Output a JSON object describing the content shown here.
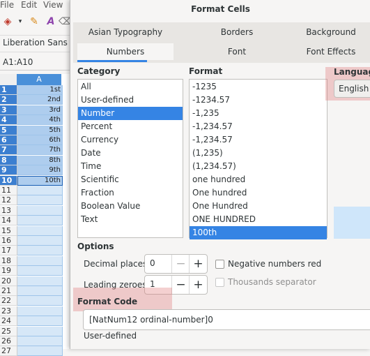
{
  "sheet": {
    "menu": [
      "File",
      "Edit",
      "View"
    ],
    "font_name": "Liberation Sans",
    "name_box": "A1:A10",
    "column_header": "A",
    "rows": [
      {
        "num": "1",
        "value": "1st"
      },
      {
        "num": "2",
        "value": "2nd"
      },
      {
        "num": "3",
        "value": "3rd"
      },
      {
        "num": "4",
        "value": "4th"
      },
      {
        "num": "5",
        "value": "5th"
      },
      {
        "num": "6",
        "value": "6th"
      },
      {
        "num": "7",
        "value": "7th"
      },
      {
        "num": "8",
        "value": "8th"
      },
      {
        "num": "9",
        "value": "9th"
      },
      {
        "num": "10",
        "value": "10th"
      },
      {
        "num": "11",
        "value": ""
      },
      {
        "num": "12",
        "value": ""
      },
      {
        "num": "13",
        "value": ""
      },
      {
        "num": "14",
        "value": ""
      },
      {
        "num": "15",
        "value": ""
      },
      {
        "num": "16",
        "value": ""
      },
      {
        "num": "17",
        "value": ""
      },
      {
        "num": "18",
        "value": ""
      },
      {
        "num": "19",
        "value": ""
      },
      {
        "num": "20",
        "value": ""
      },
      {
        "num": "21",
        "value": ""
      },
      {
        "num": "22",
        "value": ""
      },
      {
        "num": "23",
        "value": ""
      },
      {
        "num": "24",
        "value": ""
      },
      {
        "num": "25",
        "value": ""
      },
      {
        "num": "26",
        "value": ""
      },
      {
        "num": "27",
        "value": ""
      }
    ]
  },
  "dialog": {
    "title": "Format Cells",
    "tabs_row1": [
      "Asian Typography",
      "Borders",
      "Background"
    ],
    "tabs_row2": [
      "Numbers",
      "Font",
      "Font Effects"
    ],
    "category_label": "Category",
    "categories": [
      "All",
      "User-defined",
      "Number",
      "Percent",
      "Currency",
      "Date",
      "Time",
      "Scientific",
      "Fraction",
      "Boolean Value",
      "Text"
    ],
    "selected_category": "Number",
    "format_label": "Format",
    "formats": [
      "-1235",
      "-1234.57",
      "-1,235",
      "-1,234.57",
      "-1,234.57",
      "(1,235)",
      "(1,234.57)",
      "one hundred",
      "One hundred",
      "One Hundred",
      "ONE HUNDRED",
      "100th"
    ],
    "selected_format": "100th",
    "language_label": "Language",
    "language_value": "English (U",
    "options_label": "Options",
    "decimal_places_label": "Decimal places:",
    "decimal_places_value": "0",
    "leading_zeroes_label": "Leading zeroes:",
    "leading_zeroes_value": "1",
    "negative_red_label": "Negative numbers red",
    "thousands_sep_label": "Thousands separator",
    "format_code_label": "Format Code",
    "format_code_value": "[NatNum12 ordinal-number]0",
    "format_status": "User-defined"
  }
}
